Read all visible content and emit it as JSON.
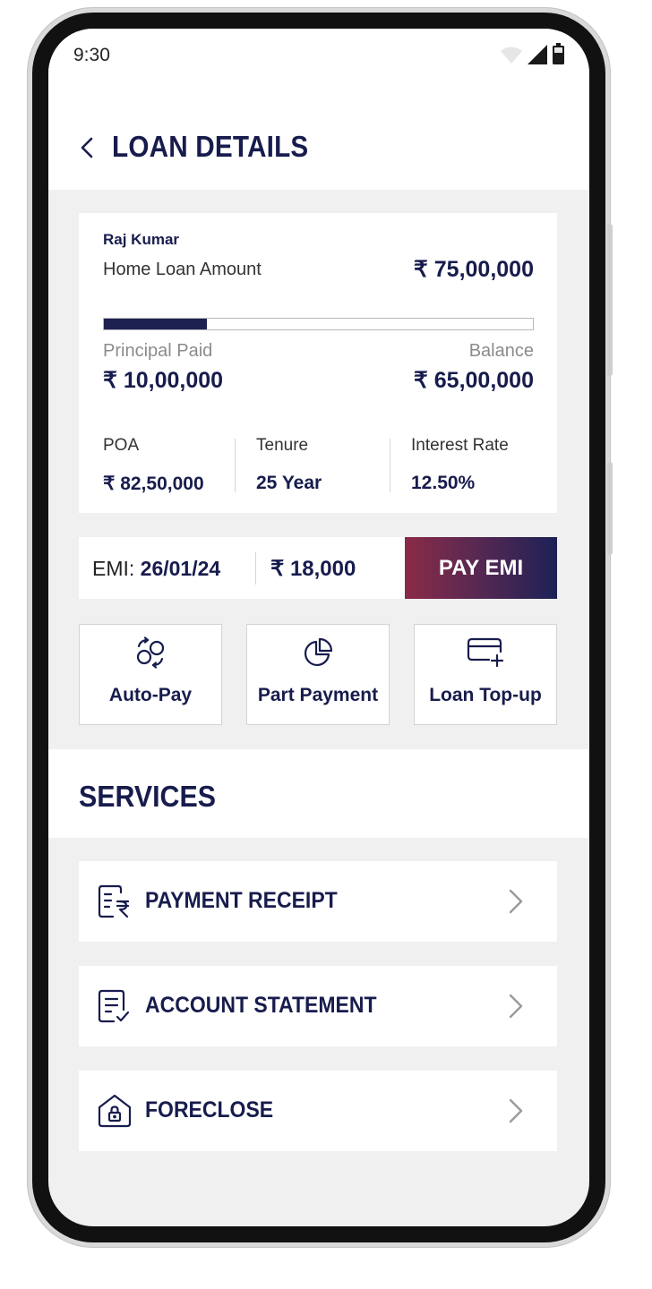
{
  "status_bar": {
    "time": "9:30"
  },
  "header": {
    "title": "LOAN DETAILS"
  },
  "loan": {
    "holder_name": "Raj Kumar",
    "loan_label": "Home Loan Amount",
    "loan_amount": "₹ 75,00,000",
    "principal_paid_label": "Principal Paid",
    "principal_paid": "₹ 10,00,000",
    "balance_label": "Balance",
    "balance": "₹ 65,00,000",
    "repaid_fraction": 0.24,
    "stats": [
      {
        "label": "POA",
        "value": "₹ 82,50,000"
      },
      {
        "label": "Tenure",
        "value": "25 Year"
      },
      {
        "label": "Interest Rate",
        "value": "12.50%"
      }
    ]
  },
  "emi": {
    "label": "EMI:",
    "date": "26/01/24",
    "amount": "₹ 18,000",
    "pay_button": "PAY EMI"
  },
  "actions": [
    {
      "label": "Auto-Pay",
      "icon": "autopay-icon"
    },
    {
      "label": "Part Payment",
      "icon": "pie-chart-icon"
    },
    {
      "label": "Loan Top-up",
      "icon": "card-add-icon"
    }
  ],
  "services": {
    "title": "SERVICES",
    "items": [
      {
        "label": "PAYMENT RECEIPT",
        "icon": "receipt-rupee-icon"
      },
      {
        "label": "ACCOUNT STATEMENT",
        "icon": "statement-check-icon"
      },
      {
        "label": "FORECLOSE",
        "icon": "house-lock-icon"
      }
    ]
  },
  "colors": {
    "primary": "#171c4d",
    "pay_gradient_start": "#8b2a46",
    "pay_gradient_end": "#1d2156",
    "screen_bg": "#f0f0f0"
  }
}
